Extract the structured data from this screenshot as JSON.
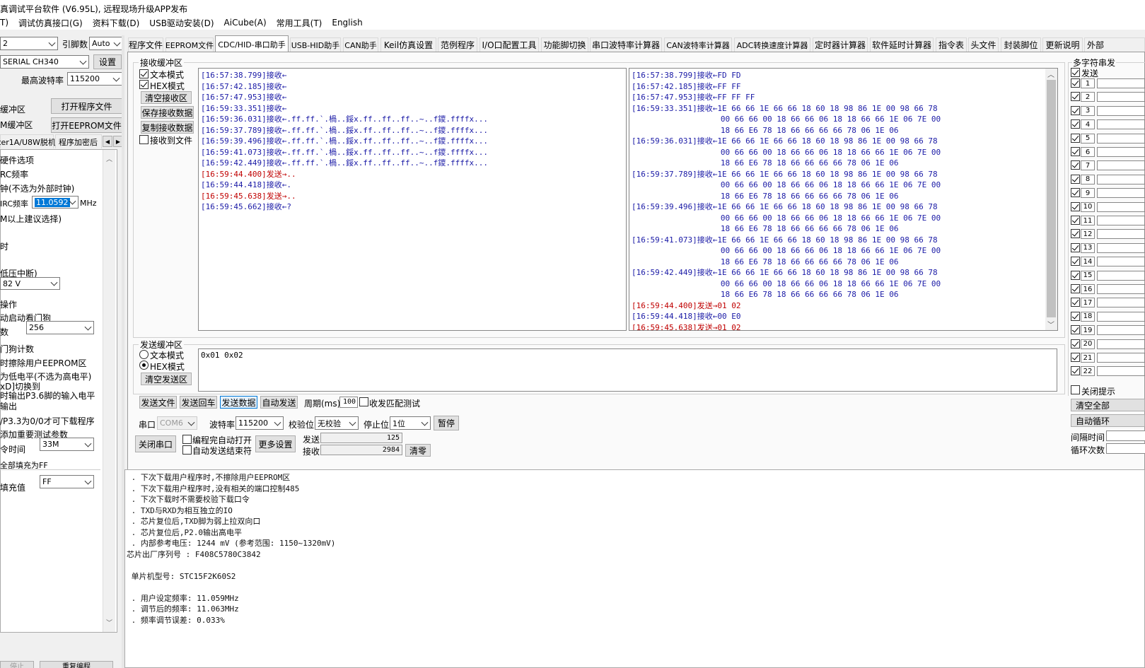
{
  "window": {
    "title": "真调试平台软件 (V6.95L), 远程现场升级APP发布"
  },
  "menu": [
    "T)",
    "调试仿真接口(G)",
    "资料下载(D)",
    "USB驱动安装(D)",
    "AiCube(A)",
    "常用工具(T)",
    "English"
  ],
  "left": {
    "mcu_sel": "2",
    "pin_label": "引脚数",
    "pin_value": "Auto",
    "port_value": "SERIAL CH340",
    "scan_btn": "设置",
    "max_baud_label": "最高波特率",
    "max_baud_value": "115200",
    "buf1": "缓冲区",
    "buf2": "M缓冲区",
    "open_prog_btn": "打开程序文件",
    "open_eeprom_btn": "打开EEPROM文件",
    "tab1": "ter1A/U8W脱机",
    "tab2": "程序加密后",
    "opts": [
      "硬件选项",
      "RC频率",
      "钟(不选为外部时钟)",
      "IRC频率",
      "M以上建议选择)",
      "时",
      "低压中断)",
      "操作",
      "动启动看门狗",
      "数",
      "门狗计数",
      "时擦除用户EEPROM区",
      "为低电平(不选为高电平)",
      "xD]切换到",
      "时输出P3.6脚的输入电平",
      "输出",
      "/P3.3为0/0才可下载程序",
      "添加重要测试参数",
      "令时间",
      "全部填充为FF",
      "填充值"
    ],
    "irc_value": "11.0592",
    "irc_unit": "MHz",
    "volt_value": "82 V",
    "wdt_value": "256",
    "cmd_time_value": "33M",
    "fill_value": "FF",
    "bottom_btn1": "停止",
    "bottom_btn2": "重复编程"
  },
  "tabs": [
    "程序文件",
    "EEPROM文件",
    "CDC/HID-串口助手",
    "USB-HID助手",
    "CAN助手",
    "Keil仿真设置",
    "范例程序",
    "I/O口配置工具",
    "功能脚切换",
    "串口波特率计算器",
    "CAN波特率计算器",
    "ADC转换速度计算器",
    "定时器计算器",
    "软件延时计算器",
    "指令表",
    "头文件",
    "封装脚位",
    "更新说明",
    "外部"
  ],
  "recv": {
    "title": "接收缓冲区",
    "text_mode": "文本模式",
    "hex_mode": "HEX模式",
    "clear_btn": "清空接收区",
    "save_btn": "保存接收数据",
    "copy_btn": "复制接收数据",
    "to_file": "接收到文件",
    "text_lines": [
      {
        "t": "[16:57:38.799]接收←",
        "c": "rx"
      },
      {
        "t": "[16:57:42.185]接收←",
        "c": "rx"
      },
      {
        "t": "[16:57:47.953]接收←",
        "c": "rx"
      },
      {
        "t": "[16:59:33.351]接收←",
        "c": "rx"
      },
      {
        "t": "[16:59:36.031]接收←.ff.ff.`.楇..鋖x.ff..ff..ff..~..f鑁.ffffx...",
        "c": "rx"
      },
      {
        "t": "[16:59:37.789]接收←.ff.ff.`.楇..鋖x.ff..ff..ff..~..f鑁.ffffx...",
        "c": "rx"
      },
      {
        "t": "[16:59:39.496]接收←.ff.ff.`.楇..鋖x.ff..ff..ff..~..f鑁.ffffx...",
        "c": "rx"
      },
      {
        "t": "[16:59:41.073]接收←.ff.ff.`.楇..鋖x.ff..ff..ff..~..f鑁.ffffx...",
        "c": "rx"
      },
      {
        "t": "[16:59:42.449]接收←.ff.ff.`.楇..鋖x.ff..ff..ff..~..f鑁.ffffx...",
        "c": "rx"
      },
      {
        "t": "[16:59:44.400]发送→..",
        "c": "tx"
      },
      {
        "t": "[16:59:44.418]接收←.",
        "c": "rx"
      },
      {
        "t": "[16:59:45.638]发送→..",
        "c": "tx"
      },
      {
        "t": "[16:59:45.662]接收←?",
        "c": "rx"
      }
    ],
    "hex_lines": [
      {
        "t": "[16:57:38.799]接收←FD FD",
        "c": "rx"
      },
      {
        "t": "[16:57:42.185]接收←FF FF",
        "c": "rx"
      },
      {
        "t": "[16:57:47.953]接收←FF FF FF",
        "c": "rx"
      },
      {
        "t": "[16:59:33.351]接收←1E 66 66 1E 66 66 18 60 18 98 86 1E 00 98 66 78",
        "c": "rx"
      },
      {
        "t": "                   00 66 66 00 18 66 66 06 18 18 66 66 1E 06 7E 00",
        "c": "rx"
      },
      {
        "t": "                   18 66 E6 78 18 66 66 66 66 78 06 1E 06",
        "c": "rx"
      },
      {
        "t": "[16:59:36.031]接收←1E 66 66 1E 66 66 18 60 18 98 86 1E 00 98 66 78",
        "c": "rx"
      },
      {
        "t": "                   00 66 66 00 18 66 66 06 18 18 66 66 1E 06 7E 00",
        "c": "rx"
      },
      {
        "t": "                   18 66 E6 78 18 66 66 66 66 78 06 1E 06",
        "c": "rx"
      },
      {
        "t": "[16:59:37.789]接收←1E 66 66 1E 66 66 18 60 18 98 86 1E 00 98 66 78",
        "c": "rx"
      },
      {
        "t": "                   00 66 66 00 18 66 66 06 18 18 66 66 1E 06 7E 00",
        "c": "rx"
      },
      {
        "t": "                   18 66 E6 78 18 66 66 66 66 78 06 1E 06",
        "c": "rx"
      },
      {
        "t": "[16:59:39.496]接收←1E 66 66 1E 66 66 18 60 18 98 86 1E 00 98 66 78",
        "c": "rx"
      },
      {
        "t": "                   00 66 66 00 18 66 66 06 18 18 66 66 1E 06 7E 00",
        "c": "rx"
      },
      {
        "t": "                   18 66 E6 78 18 66 66 66 66 78 06 1E 06",
        "c": "rx"
      },
      {
        "t": "[16:59:41.073]接收←1E 66 66 1E 66 66 18 60 18 98 86 1E 00 98 66 78",
        "c": "rx"
      },
      {
        "t": "                   00 66 66 00 18 66 66 06 18 18 66 66 1E 06 7E 00",
        "c": "rx"
      },
      {
        "t": "                   18 66 E6 78 18 66 66 66 66 78 06 1E 06",
        "c": "rx"
      },
      {
        "t": "[16:59:42.449]接收←1E 66 66 1E 66 66 18 60 18 98 86 1E 00 98 66 78",
        "c": "rx"
      },
      {
        "t": "                   00 66 66 00 18 66 66 06 18 18 66 66 1E 06 7E 00",
        "c": "rx"
      },
      {
        "t": "                   18 66 E6 78 18 66 66 66 66 78 06 1E 06",
        "c": "rx"
      },
      {
        "t": "[16:59:44.400]发送→01 02",
        "c": "tx"
      },
      {
        "t": "[16:59:44.418]接收←00 E0",
        "c": "rx"
      },
      {
        "t": "[16:59:45.638]发送→01 02",
        "c": "tx"
      }
    ]
  },
  "send": {
    "title": "发送缓冲区",
    "text_mode": "文本模式",
    "hex_mode": "HEX模式",
    "clear_btn": "清空发送区",
    "content": "0x01 0x02",
    "send_file_btn": "发送文件",
    "send_cr_btn": "发送回车",
    "send_data_btn": "发送数据",
    "auto_send_btn": "自动发送",
    "period_label": "周期(ms)",
    "period_value": "100",
    "match_label": "收发匹配测试"
  },
  "serial": {
    "port_label": "串口",
    "port_value": "COM6",
    "baud_label": "波特率",
    "baud_value": "115200",
    "parity_label": "校验位",
    "parity_value": "无校验",
    "stop_label": "停止位",
    "stop_value": "1位",
    "pause_btn": "暂停",
    "close_btn": "关闭串口",
    "auto_open": "编程完自动打开",
    "auto_end": "自动发送结束符",
    "more_btn": "更多设置",
    "sent_label": "发送",
    "sent_value": "125",
    "recv_label": "接收",
    "recv_value": "2984",
    "clear_btn": "清零"
  },
  "right": {
    "title": "多字符串发",
    "send_label": "发送",
    "rows": [
      "1",
      "2",
      "3",
      "4",
      "5",
      "6",
      "7",
      "8",
      "9",
      "10",
      "11",
      "12",
      "13",
      "14",
      "15",
      "16",
      "17",
      "18",
      "19",
      "20",
      "21",
      "22"
    ],
    "close_tip": "关闭提示",
    "clear_all": "清空全部",
    "auto_loop": "自动循环",
    "interval": "间隔时间",
    "loop_count": "循环次数"
  },
  "log": [
    " . 下次下载用户程序时,不擦除用户EEPROM区",
    " . 下次下载用户程序时,没有相关的端口控制485",
    " . 下次下载时不需要校验下载口令",
    " . TXD与RXD为相互独立的IO",
    " . 芯片复位后,TXD脚为弱上拉双向口",
    " . 芯片复位后,P2.0输出高电平",
    " . 内部参考电压: 1244 mV (参考范围: 1150~1320mV)",
    "芯片出厂序列号 : F408C5780C3842",
    "",
    " 单片机型号: STC15F2K60S2",
    "",
    " . 用户设定频率: 11.059MHz",
    " . 调节后的频率: 11.063MHz",
    " . 频率调节误差: 0.033%"
  ]
}
